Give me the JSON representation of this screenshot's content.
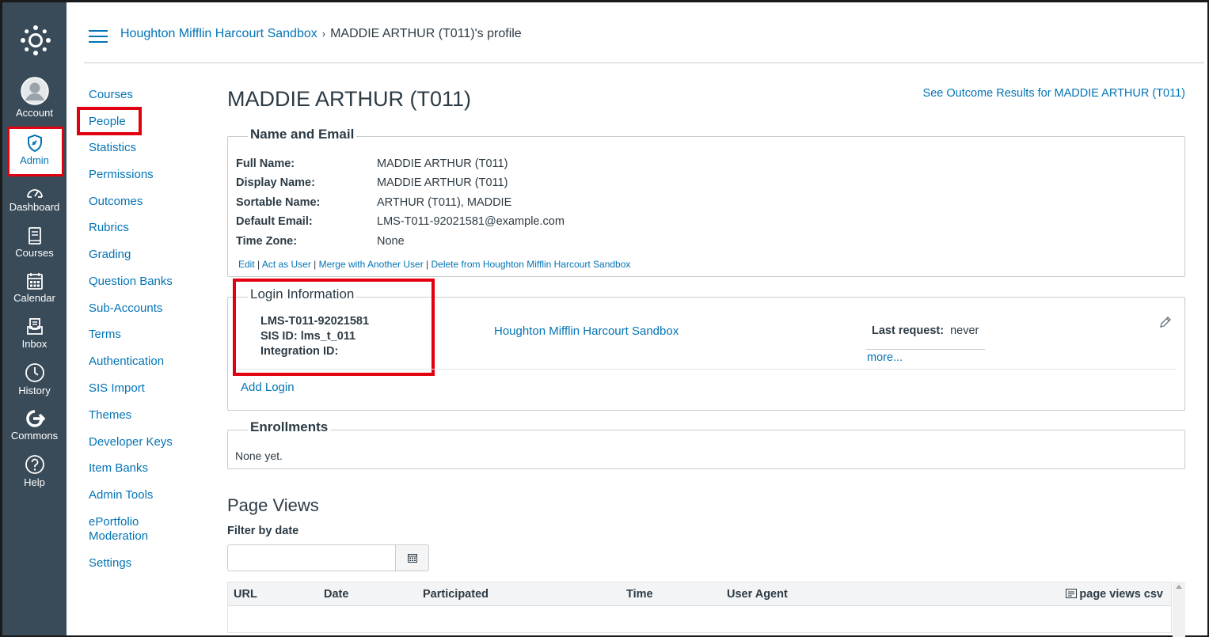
{
  "global_nav": {
    "items": [
      {
        "label": "Account",
        "icon": "avatar-icon"
      },
      {
        "label": "Admin",
        "icon": "shield-icon"
      },
      {
        "label": "Dashboard",
        "icon": "speedometer-icon"
      },
      {
        "label": "Courses",
        "icon": "book-icon"
      },
      {
        "label": "Calendar",
        "icon": "calendar-icon"
      },
      {
        "label": "Inbox",
        "icon": "inbox-icon"
      },
      {
        "label": "History",
        "icon": "clock-icon"
      },
      {
        "label": "Commons",
        "icon": "commons-icon"
      },
      {
        "label": "Help",
        "icon": "help-icon"
      }
    ],
    "bg_color": "#394b58",
    "highlight_color": "#e1000f"
  },
  "header": {
    "breadcrumb_account": "Houghton Mifflin Harcourt Sandbox",
    "breadcrumb_separator": "›",
    "breadcrumb_current": "MADDIE ARTHUR (T011)'s profile"
  },
  "subnav": {
    "items": [
      "Courses",
      "People",
      "Statistics",
      "Permissions",
      "Outcomes",
      "Rubrics",
      "Grading",
      "Question Banks",
      "Sub-Accounts",
      "Terms",
      "Authentication",
      "SIS Import",
      "Themes",
      "Developer Keys",
      "Item Banks",
      "Admin Tools",
      "ePortfolio",
      "Moderation",
      "Settings"
    ]
  },
  "profile": {
    "title": "MADDIE ARTHUR (T011)",
    "outcome_link": "See Outcome Results for MADDIE ARTHUR (T011)",
    "name_email": {
      "legend": "Name and Email",
      "rows": [
        {
          "label": "Full Name:",
          "value": "MADDIE ARTHUR (T011)"
        },
        {
          "label": "Display Name:",
          "value": "MADDIE ARTHUR (T011)"
        },
        {
          "label": "Sortable Name:",
          "value": "ARTHUR (T011), MADDIE"
        },
        {
          "label": "Default Email:",
          "value": "LMS-T011-92021581@example.com"
        },
        {
          "label": "Time Zone:",
          "value": "None"
        }
      ],
      "actions": [
        "Edit",
        "Act as User",
        "Merge with Another User",
        "Delete from Houghton Mifflin Harcourt Sandbox"
      ],
      "action_sep": " | "
    },
    "login": {
      "legend": "Login Information",
      "login_id": "LMS-T011-92021581",
      "sis_id": "SIS ID: lms_t_011",
      "integration_id": "Integration ID:",
      "account": "Houghton Mifflin Harcourt Sandbox",
      "last_request_label": "Last request:",
      "last_request_value": "never",
      "more": "more...",
      "add_login": "Add Login"
    },
    "enrollments": {
      "legend": "Enrollments",
      "empty": "None yet."
    },
    "page_views": {
      "title": "Page Views",
      "filter_label": "Filter by date",
      "date_value": "",
      "columns": [
        "URL",
        "Date",
        "Participated",
        "Time",
        "User Agent"
      ],
      "csv_label": "page views csv"
    }
  }
}
